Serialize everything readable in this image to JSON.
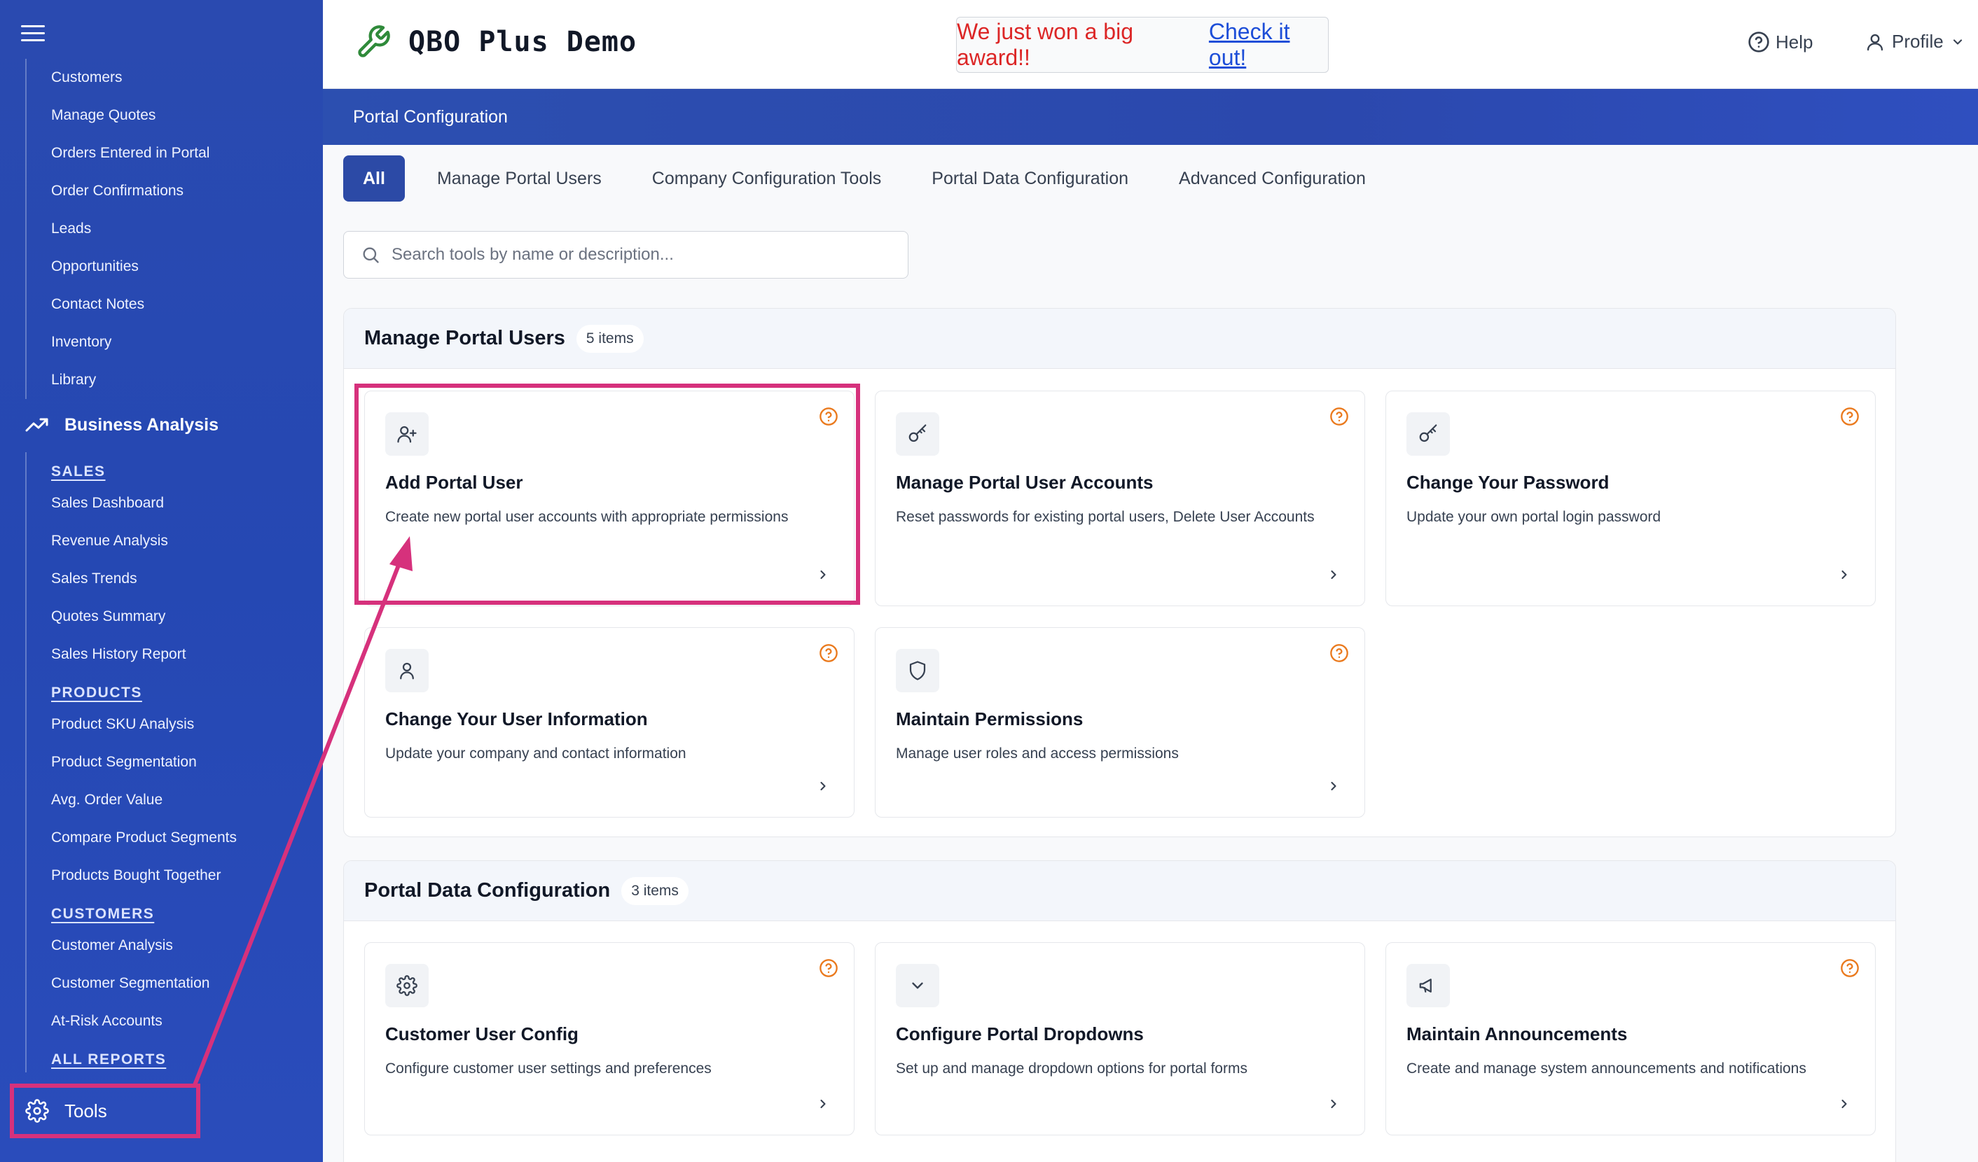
{
  "sidebar": {
    "items_top": [
      "Customers",
      "Manage Quotes",
      "Orders Entered in Portal",
      "Order Confirmations",
      "Leads",
      "Opportunities",
      "Contact Notes",
      "Inventory",
      "Library"
    ],
    "section_title": "Business Analysis",
    "sales_heading": "SALES",
    "sales_items": [
      "Sales Dashboard",
      "Revenue Analysis",
      "Sales Trends",
      "Quotes Summary",
      "Sales History Report"
    ],
    "products_heading": "PRODUCTS",
    "products_items": [
      "Product SKU Analysis",
      "Product Segmentation",
      "Avg. Order Value",
      "Compare Product Segments",
      "Products Bought Together"
    ],
    "customers_heading": "CUSTOMERS",
    "customers_items": [
      "Customer Analysis",
      "Customer Segmentation",
      "At-Risk Accounts"
    ],
    "all_reports": "ALL REPORTS",
    "tools_label": "Tools"
  },
  "header": {
    "brand": "QBO Plus Demo",
    "award_text": "We just won a big award!!",
    "award_link": "Check it out!",
    "help": "Help",
    "profile": "Profile"
  },
  "pagebar": {
    "title": "Portal Configuration"
  },
  "tabs": [
    "All",
    "Manage Portal Users",
    "Company Configuration Tools",
    "Portal Data Configuration",
    "Advanced Configuration"
  ],
  "search": {
    "placeholder": "Search tools by name or description..."
  },
  "panels": [
    {
      "title": "Manage Portal Users",
      "count": "5 items",
      "cards": [
        {
          "title": "Add Portal User",
          "desc": "Create new portal user accounts with appropriate permissions",
          "icon": "user-plus-icon"
        },
        {
          "title": "Manage Portal User Accounts",
          "desc": "Reset passwords for existing portal users, Delete User Accounts",
          "icon": "key-icon"
        },
        {
          "title": "Change Your Password",
          "desc": "Update your own portal login password",
          "icon": "key-icon"
        },
        {
          "title": "Change Your User Information",
          "desc": "Update your company and contact information",
          "icon": "user-icon"
        },
        {
          "title": "Maintain Permissions",
          "desc": "Manage user roles and access permissions",
          "icon": "shield-icon"
        }
      ]
    },
    {
      "title": "Portal Data Configuration",
      "count": "3 items",
      "cards": [
        {
          "title": "Customer User Config",
          "desc": "Configure customer user settings and preferences",
          "icon": "gear-icon"
        },
        {
          "title": "Configure Portal Dropdowns",
          "desc": "Set up and manage dropdown options for portal forms",
          "icon": "chevron-down-icon"
        },
        {
          "title": "Maintain Announcements",
          "desc": "Create and manage system announcements and notifications",
          "icon": "megaphone-icon"
        }
      ]
    }
  ],
  "colors": {
    "sidebar": "#2a4ab0",
    "accent": "#2c4aa6",
    "annotation": "#d6317c",
    "help_icon": "#ea7a1e"
  }
}
